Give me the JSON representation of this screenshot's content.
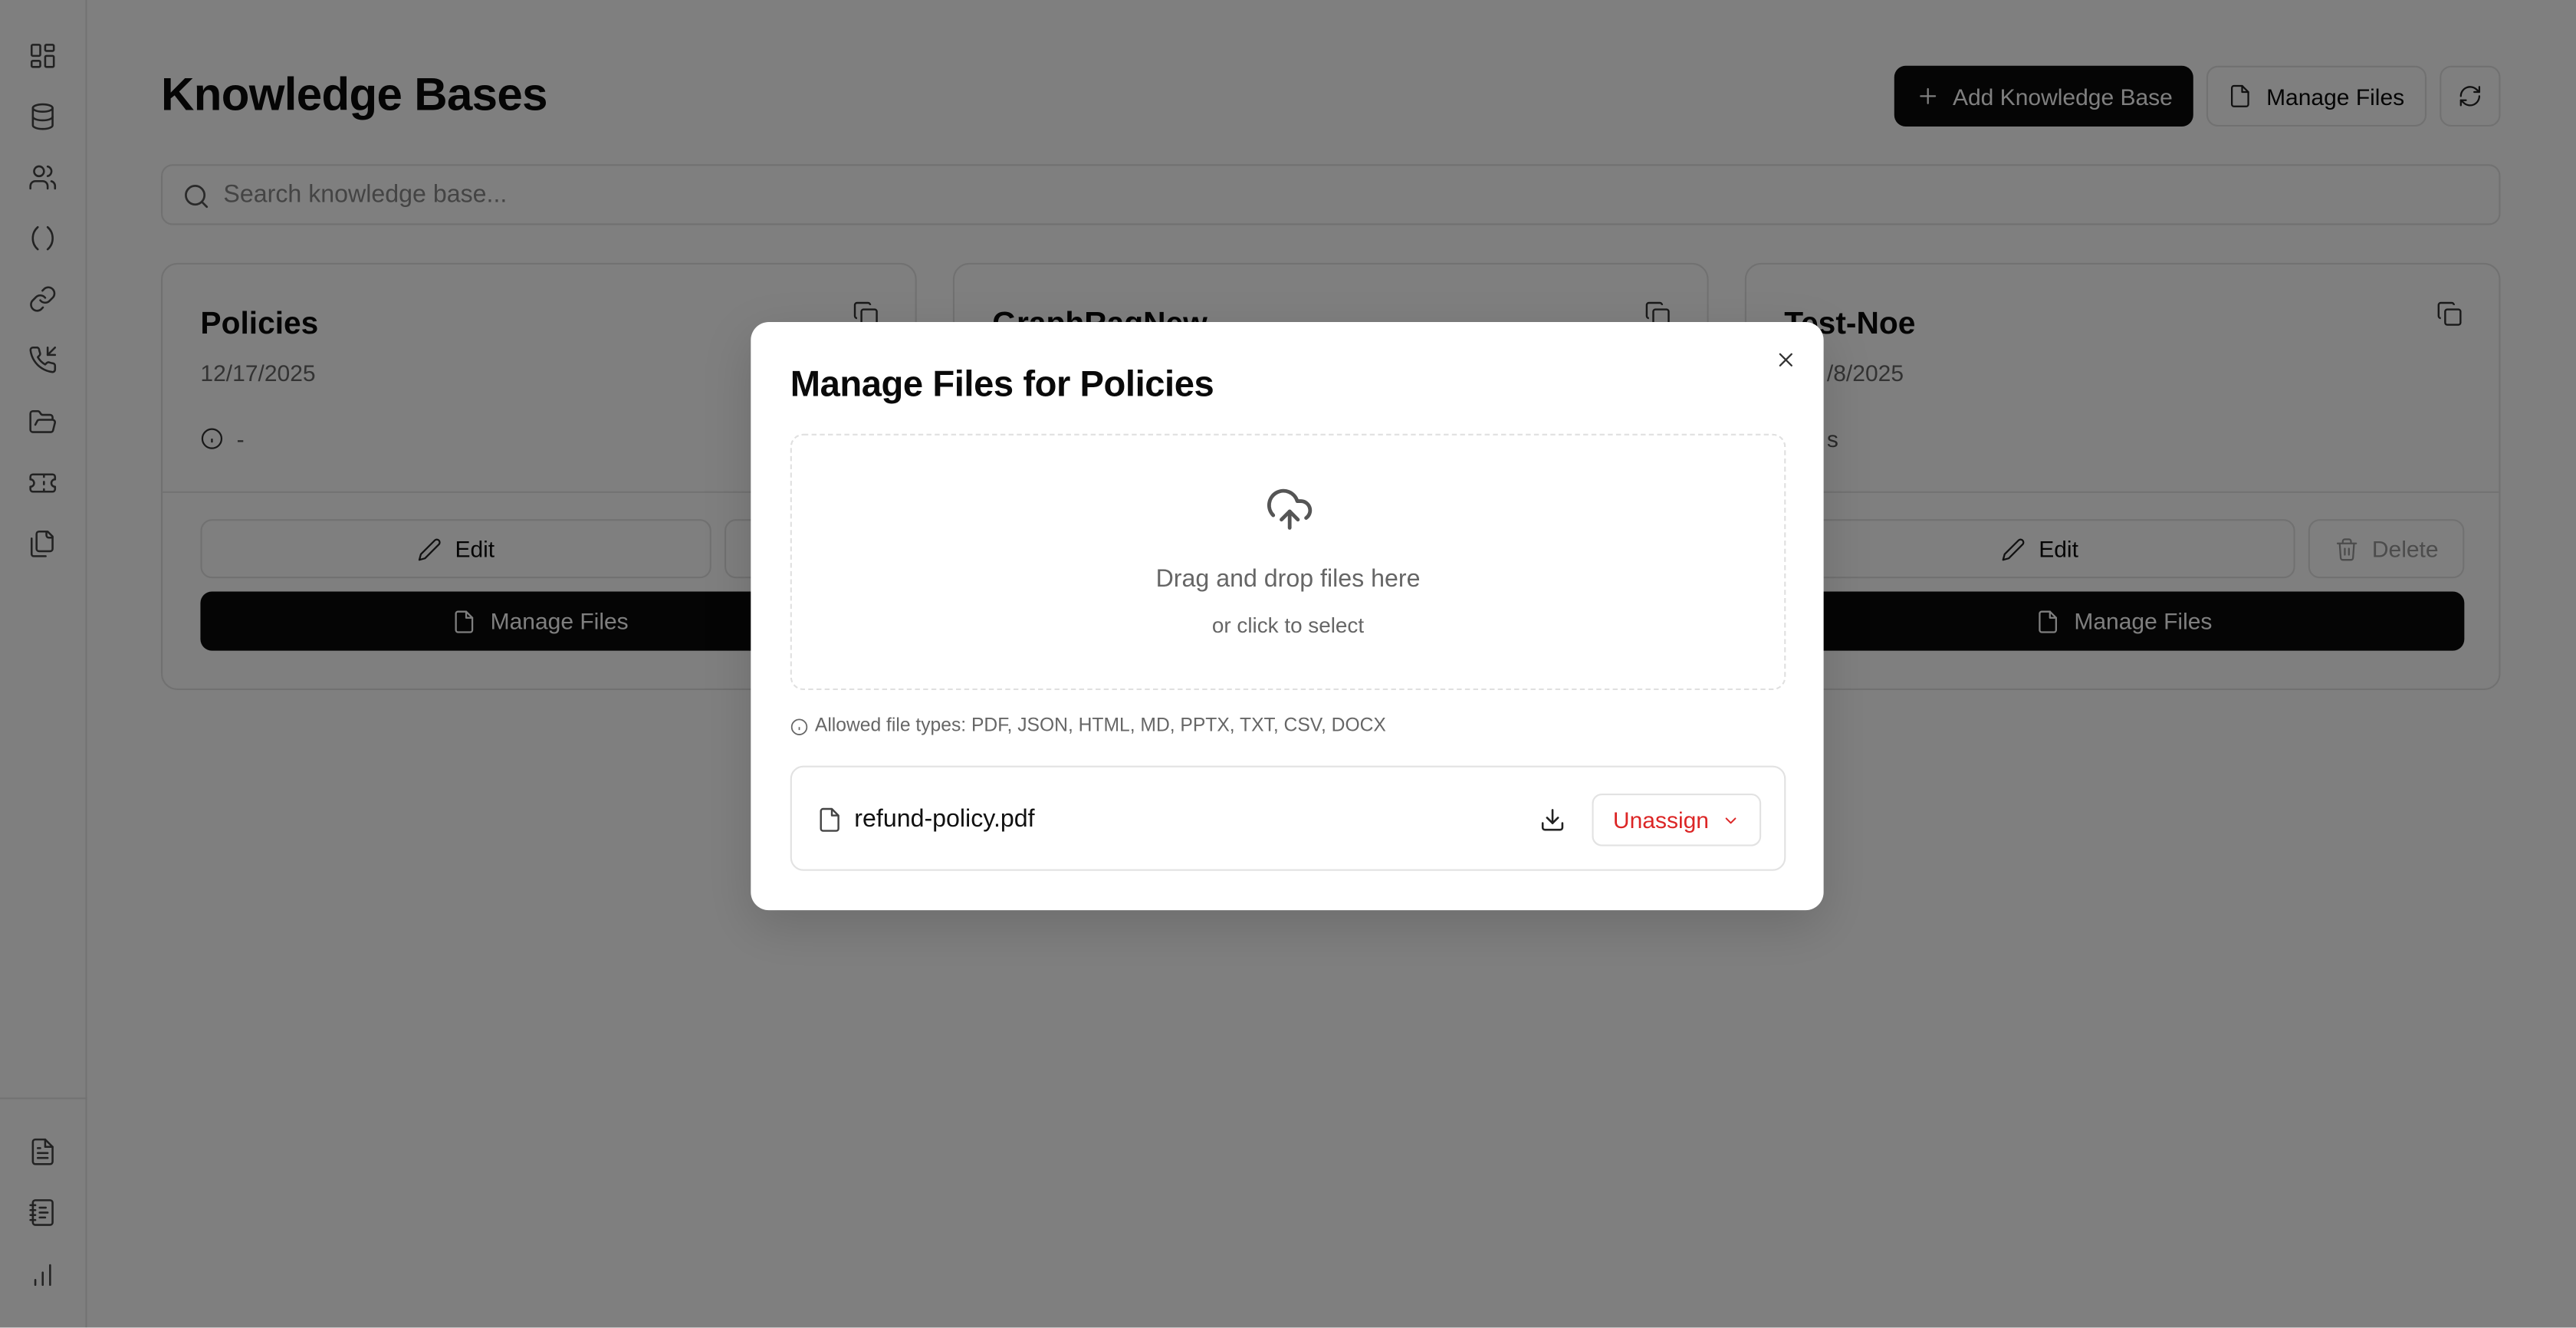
{
  "page": {
    "title": "Knowledge Bases",
    "add_button": "Add Knowledge Base",
    "manage_files_button": "Manage Files"
  },
  "search": {
    "placeholder": "Search knowledge base..."
  },
  "sidebar": {
    "icons": [
      "dashboard-icon",
      "database-icon",
      "users-icon",
      "parentheses-icon",
      "link-icon",
      "phone-incoming-icon",
      "folder-open-icon",
      "ticket-icon",
      "files-icon"
    ],
    "bottom_icons": [
      "file-text-icon",
      "notebook-icon",
      "bar-chart-icon"
    ]
  },
  "cards": [
    {
      "title": "Policies",
      "date": "12/17/2025",
      "info": "-",
      "edit": "Edit",
      "manage": "Manage Files"
    },
    {
      "title": "GraphRagNew"
    },
    {
      "title": "Test-Noe",
      "date": "/8/2025",
      "info": "s",
      "edit": "Edit",
      "delete": "Delete",
      "manage": "Manage Files"
    }
  ],
  "modal": {
    "title": "Manage Files for Policies",
    "drop_main": "Drag and drop files here",
    "drop_sub": "or click to select",
    "allowed": "Allowed file types: PDF, JSON, HTML, MD, PPTX, TXT, CSV, DOCX",
    "files": [
      {
        "name": "refund-policy.pdf",
        "action": "Unassign"
      }
    ]
  },
  "colors": {
    "primary": "#0a0a0a",
    "danger": "#dc2626",
    "overlay": "rgba(0,0,0,0.5)"
  }
}
